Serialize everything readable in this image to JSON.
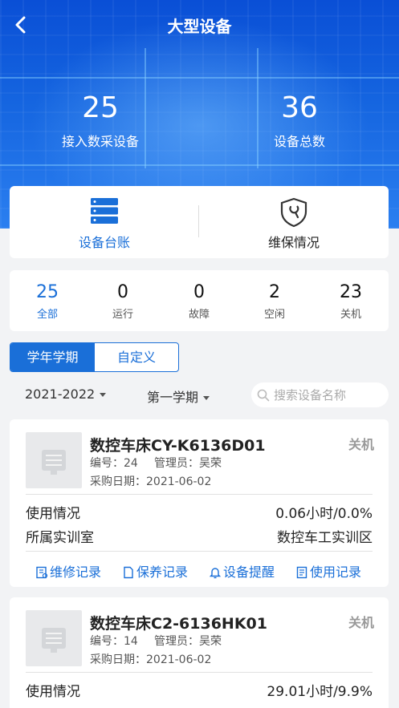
{
  "header": {
    "title": "大型设备"
  },
  "stats": [
    {
      "value": "25",
      "label": "接入数采设备"
    },
    {
      "value": "36",
      "label": "设备总数"
    }
  ],
  "quick": {
    "ledger": "设备台账",
    "maintenance": "维保情况"
  },
  "counts": [
    {
      "value": "25",
      "label": "全部"
    },
    {
      "value": "0",
      "label": "运行"
    },
    {
      "value": "0",
      "label": "故障"
    },
    {
      "value": "2",
      "label": "空闲"
    },
    {
      "value": "23",
      "label": "关机"
    }
  ],
  "segment": {
    "active": "学年学期",
    "inactive": "自定义"
  },
  "filters": {
    "year": "2021-2022",
    "term": "第一学期"
  },
  "search": {
    "placeholder": "搜索设备名称"
  },
  "devices": [
    {
      "name": "数控车床CY-K6136D01",
      "status": "关机",
      "code": "编号：24",
      "manager": "管理员：吴荣",
      "purchase": "采购日期：2021-06-02",
      "usage_label": "使用情况",
      "usage_value": "0.06小时/0.0%",
      "lab_label": "所属实训室",
      "lab_value": "数控车工实训区"
    },
    {
      "name": "数控车床C2-6136HK01",
      "status": "关机",
      "code": "编号：14",
      "manager": "管理员：吴荣",
      "purchase": "采购日期：2021-06-02",
      "usage_label": "使用情况",
      "usage_value": "29.01小时/9.9%"
    }
  ],
  "actions": {
    "repair": "维修记录",
    "maintain": "保养记录",
    "remind": "设备提醒",
    "usage": "使用记录"
  },
  "colors": {
    "primary": "#1a6fd8",
    "hero": "#1565e0"
  }
}
